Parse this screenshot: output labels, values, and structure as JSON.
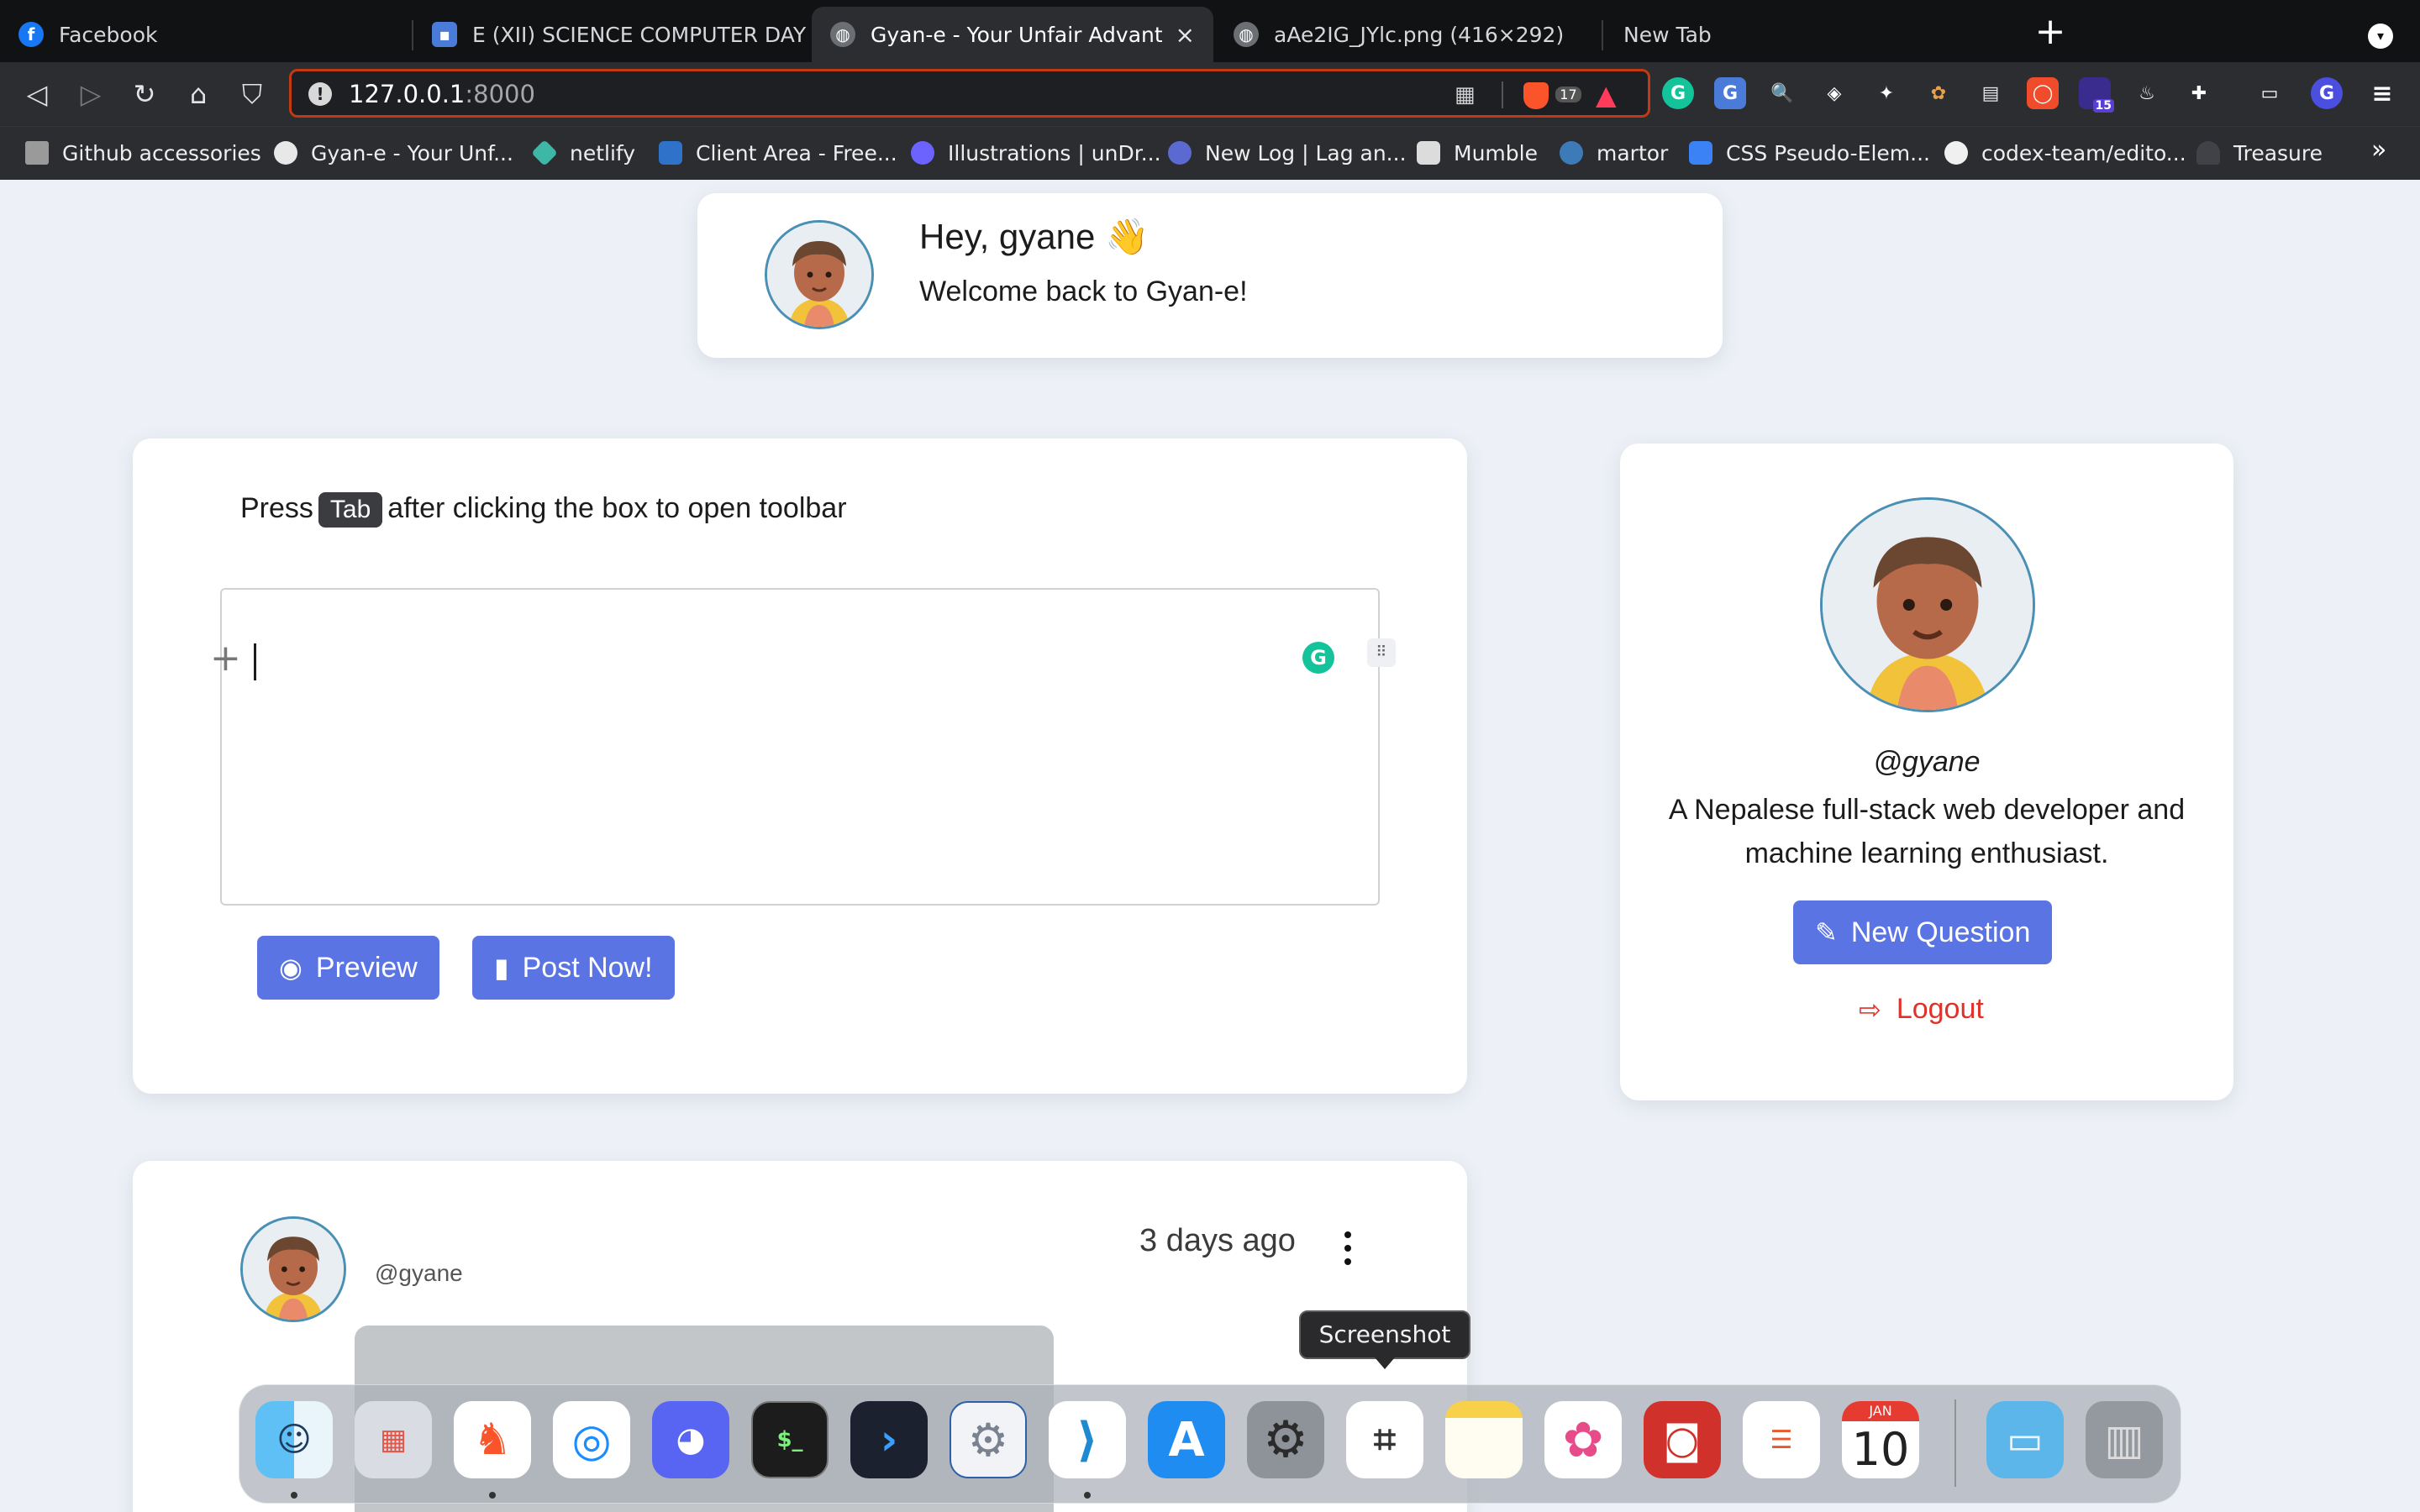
{
  "browser": {
    "tabs": [
      {
        "label": "Facebook",
        "active": false
      },
      {
        "label": "E (XII) SCIENCE COMPUTER DAY",
        "active": false
      },
      {
        "label": "Gyan-e - Your Unfair Advantage",
        "active": true
      },
      {
        "label": "aAe2IG_JYlc.png (416×292)",
        "active": false
      },
      {
        "label": "New Tab",
        "active": false
      }
    ],
    "new_tab_symbol": "+",
    "address": {
      "host": "127.0.0.1",
      "port": ":8000"
    },
    "shield_count": "17",
    "extension_badge": "15",
    "bookmarks": [
      "Github accessories",
      "Gyan-e - Your Unf...",
      "netlify",
      "Client Area - Free...",
      "Illustrations | unDr...",
      "New Log | Lag an...",
      "Mumble",
      "martor",
      "CSS Pseudo-Elem...",
      "codex-team/edito...",
      "Treasure"
    ],
    "bookmarks_overflow": "»"
  },
  "welcome": {
    "title": "Hey, gyane 👋",
    "subtitle": "Welcome back to Gyan-e!"
  },
  "composer": {
    "hint_before": "Press",
    "hint_key": "Tab",
    "hint_after": "after clicking the box to open toolbar",
    "preview_label": "Preview",
    "post_label": "Post Now!"
  },
  "profile": {
    "handle": "@gyane",
    "bio": "A Nepalese full-stack web developer and machine learning enthusiast.",
    "new_question_label": "New Question",
    "logout_label": "Logout"
  },
  "post": {
    "username": "@gyane",
    "time": "3 days ago"
  },
  "dock": {
    "tooltip": "Screenshot",
    "calendar_month": "JAN",
    "calendar_day": "10"
  },
  "colors": {
    "accent": "#5a74e3",
    "danger": "#e0312a",
    "page_bg": "#edf1f7"
  }
}
